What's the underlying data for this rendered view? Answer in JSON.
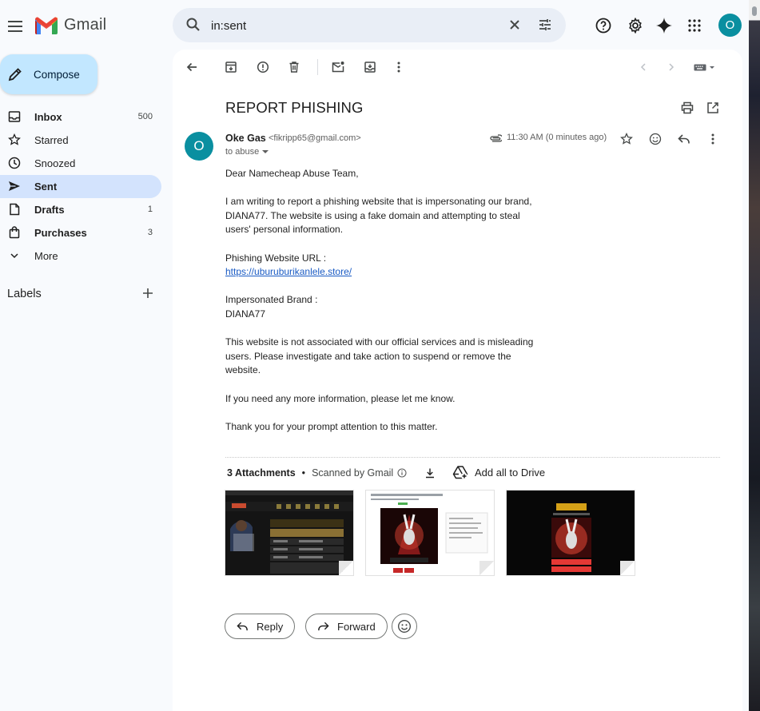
{
  "app": {
    "name": "Gmail"
  },
  "search": {
    "value": "in:sent"
  },
  "user": {
    "initial": "O"
  },
  "compose": {
    "label": "Compose"
  },
  "nav": [
    {
      "label": "Inbox",
      "count": "500",
      "bold": true
    },
    {
      "label": "Starred",
      "count": ""
    },
    {
      "label": "Snoozed",
      "count": ""
    },
    {
      "label": "Sent",
      "count": "",
      "bold": true,
      "active": true
    },
    {
      "label": "Drafts",
      "count": "1",
      "bold": true
    },
    {
      "label": "Purchases",
      "count": "3",
      "bold": true
    },
    {
      "label": "More",
      "count": ""
    }
  ],
  "labels": {
    "title": "Labels"
  },
  "email": {
    "subject": "REPORT PHISHING",
    "sender_initial": "O",
    "sender_name": "Oke Gas",
    "sender_email": "<fikripp65@gmail.com>",
    "to": "to abuse",
    "time": "11:30 AM (0 minutes ago)",
    "greeting": "Dear Namecheap Abuse Team,",
    "para1": "I am writing to report a phishing website that is impersonating our brand, DIANA77. The website is using a fake domain and attempting to steal users' personal information.",
    "url_label": "Phishing Website URL :",
    "url": "https://uburuburikanlele.store/",
    "brand_label": "Impersonated Brand :",
    "brand": "DIANA77",
    "para2": "This website is not associated with our official services and is misleading users. Please investigate and take action to suspend or remove the website.",
    "para3": "If you need any more information, please let me know.",
    "para4": "Thank you for your prompt attention to this matter."
  },
  "attachments": {
    "count_label": "3 Attachments",
    "separator": "•",
    "scanned": "Scanned by Gmail",
    "add_all": "Add all to Drive"
  },
  "actions": {
    "reply": "Reply",
    "forward": "Forward"
  },
  "colors": {
    "accent": "#c2e7ff",
    "avatar": "#0a8fa0",
    "active_nav": "#d3e3fd",
    "link": "#1a5bc4"
  }
}
